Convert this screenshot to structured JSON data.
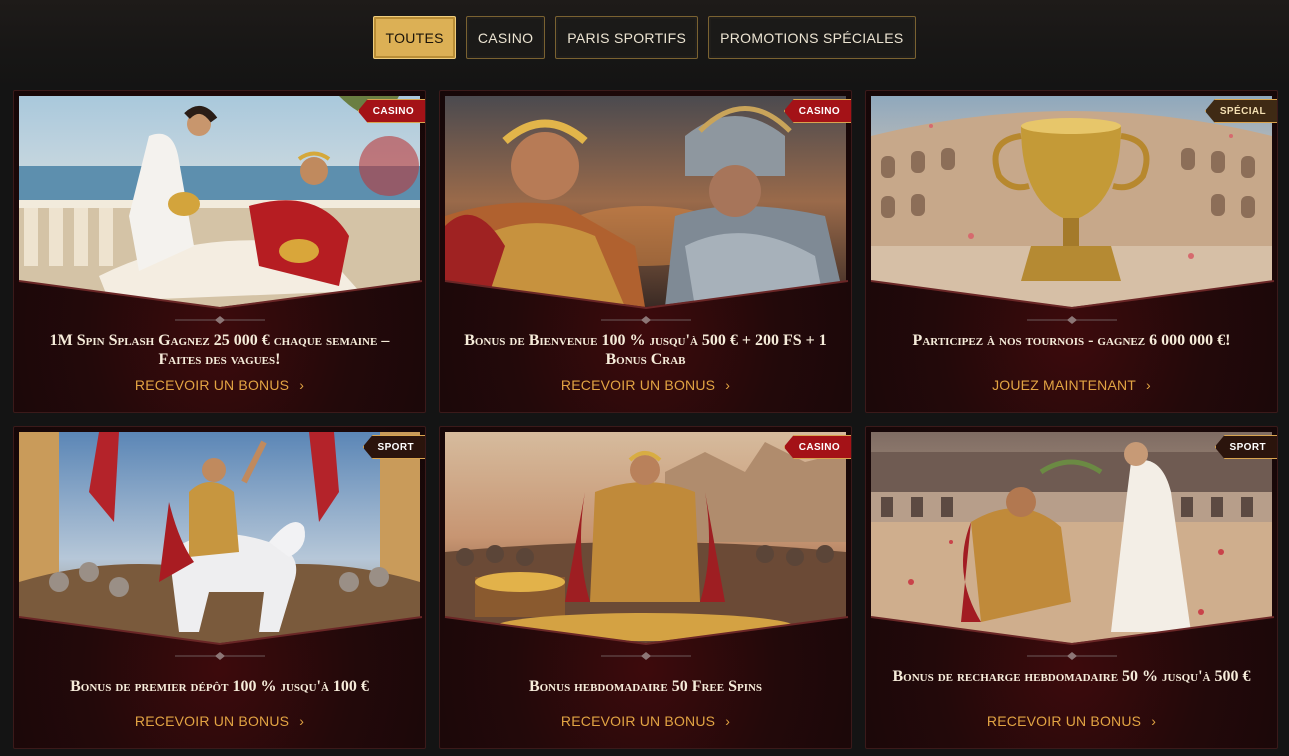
{
  "filters": [
    {
      "label": "TOUTES",
      "active": true
    },
    {
      "label": "CASINO",
      "active": false
    },
    {
      "label": "PARIS SPORTIFS",
      "active": false
    },
    {
      "label": "PROMOTIONS SPÉCIALES",
      "active": false
    }
  ],
  "cards": [
    {
      "badge": "CASINO",
      "badge_type": "casino",
      "scene": "reclining-emperor-balcony",
      "title": "1M Spin Splash Gagnez 25 000 € chaque semaine – Faites des vagues!",
      "cta": "RECEVOIR UN BONUS"
    },
    {
      "badge": "CASINO",
      "badge_type": "casino",
      "scene": "emperor-and-centurion",
      "title": "Bonus de Bienvenue 100 % jusqu'à 500 € + 200 FS + 1 Bonus Crab",
      "cta": "RECEVOIR UN BONUS"
    },
    {
      "badge": "SPÉCIAL",
      "badge_type": "special",
      "scene": "golden-trophy-colosseum",
      "title": "Participez à nos tournois - gagnez 6 000 000 €!",
      "cta": "JOUEZ MAINTENANT"
    },
    {
      "badge": "SPORT",
      "badge_type": "sport",
      "scene": "emperor-on-white-horse",
      "title": "Bonus de premier dépôt 100 % jusqu'à 100 €",
      "cta": "RECEVOIR UN BONUS"
    },
    {
      "badge": "CASINO",
      "badge_type": "casino",
      "scene": "emperor-with-gold-chests",
      "title": "Bonus hebdomadaire 50 Free Spins",
      "cta": "RECEVOIR UN BONUS"
    },
    {
      "badge": "SPORT",
      "badge_type": "sport",
      "scene": "gladiator-crowned-arena",
      "title": "Bonus de recharge hebdomadaire 50 % jusqu'à 500 €",
      "cta": "RECEVOIR UN BONUS"
    }
  ],
  "colors": {
    "accent_gold": "#dcb055",
    "cta_orange": "#e2a443",
    "badge_red": "#a41217",
    "card_bg": "#23090a"
  }
}
